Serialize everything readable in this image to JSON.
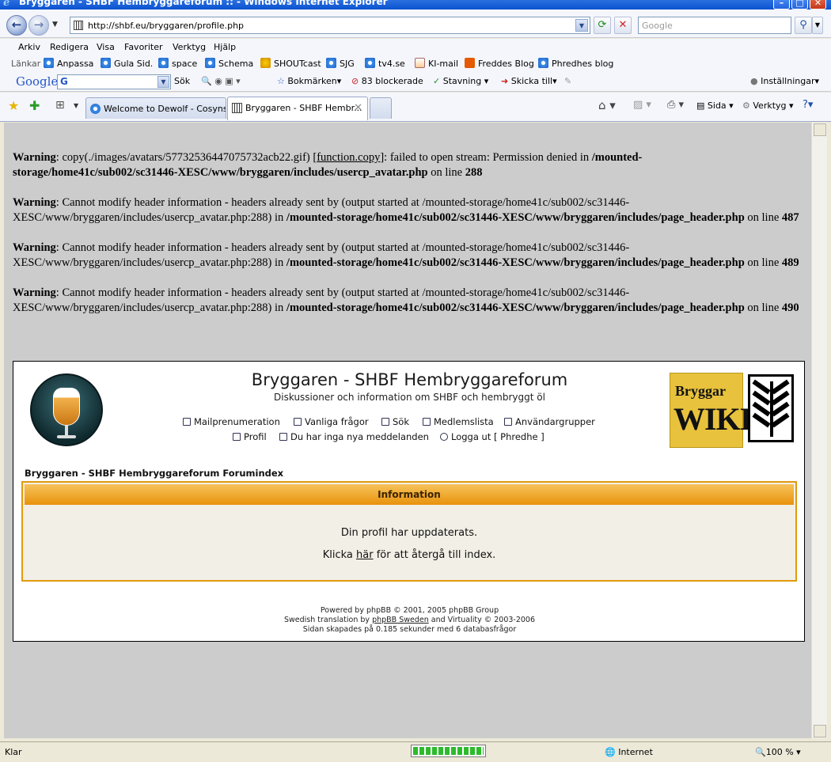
{
  "window": {
    "title": "Bryggaren - SHBF Hembryggareforum :: - Windows Internet Explorer"
  },
  "address": {
    "url": "http://shbf.eu/bryggaren/profile.php",
    "search_placeholder": "Google"
  },
  "menu": [
    "Arkiv",
    "Redigera",
    "Visa",
    "Favoriter",
    "Verktyg",
    "Hjälp"
  ],
  "links_bar": {
    "label": "Länkar",
    "items": [
      "Anpassa",
      "Gula Sid.",
      "space",
      "Schema",
      "SHOUTcast",
      "SJG",
      "tv4.se",
      "KI-mail",
      "Freddes Blog",
      "Phredhes blog"
    ]
  },
  "google_bar": {
    "logo": "Google",
    "select_value": "G",
    "search_label": "Sök",
    "bookmarks": "Bokmärken",
    "blocked": "83 blockerade",
    "spelling": "Stavning",
    "send_to": "Skicka till",
    "settings": "Inställningar"
  },
  "tabs": [
    {
      "label": "Welcome to Dewolf - Cosyns"
    },
    {
      "label": "Bryggaren - SHBF Hembr..."
    }
  ],
  "command_bar": {
    "page": "Sida",
    "tools": "Verktyg"
  },
  "warnings": [
    {
      "label": "Warning",
      "text_a": ": copy(./images/avatars/57732536447075732acb22.gif) [",
      "func": "function.copy",
      "text_b": "]: failed to open stream: Permission denied in ",
      "path": "/mounted-storage/home41c/sub002/sc31446-XESC/www/bryggaren/includes/usercp_avatar.php",
      "on_line": " on line ",
      "line": "288"
    },
    {
      "label": "Warning",
      "text": ": Cannot modify header information - headers already sent by (output started at /mounted-storage/home41c/sub002/sc31446-XESC/www/bryggaren/includes/usercp_avatar.php:288) in ",
      "path": "/mounted-storage/home41c/sub002/sc31446-XESC/www/bryggaren/includes/page_header.php",
      "on_line": " on line ",
      "line": "487"
    },
    {
      "label": "Warning",
      "text": ": Cannot modify header information - headers already sent by (output started at /mounted-storage/home41c/sub002/sc31446-XESC/www/bryggaren/includes/usercp_avatar.php:288) in ",
      "path": "/mounted-storage/home41c/sub002/sc31446-XESC/www/bryggaren/includes/page_header.php",
      "on_line": " on line ",
      "line": "489"
    },
    {
      "label": "Warning",
      "text": ": Cannot modify header information - headers already sent by (output started at /mounted-storage/home41c/sub002/sc31446-XESC/www/bryggaren/includes/usercp_avatar.php:288) in ",
      "path": "/mounted-storage/home41c/sub002/sc31446-XESC/www/bryggaren/includes/page_header.php",
      "on_line": " on line ",
      "line": "490"
    }
  ],
  "forum": {
    "title": "Bryggaren - SHBF Hembryggareforum",
    "subtitle": "Diskussioner och information om SHBF och hembryggt öl",
    "nav_row1": [
      "Mailprenumeration",
      "Vanliga frågor",
      "Sök",
      "Medlemslista",
      "Användargrupper"
    ],
    "nav_row2": [
      "Profil",
      "Du har inga nya meddelanden",
      "Logga ut [ Phredhe ]"
    ],
    "wiki_line1": "Bryggar",
    "wiki_line2": "WIKI",
    "breadcrumb": "Bryggaren - SHBF Hembryggareforum Forumindex",
    "info": {
      "header": "Information",
      "message": "Din profil har uppdaterats.",
      "link_pre": "Klicka ",
      "link": "här",
      "link_post": " för att återgå till index."
    },
    "footer": {
      "line1": "Powered by phpBB © 2001, 2005 phpBB Group",
      "line2_pre": "Swedish translation by ",
      "line2_link": "phpBB Sweden",
      "line2_post": " and Virtuality © 2003-2006",
      "line3": "Sidan skapades på 0.185 sekunder med 6 databasfrågor"
    }
  },
  "status": {
    "left": "Klar",
    "zone": "Internet",
    "zoom": "100 %",
    "progress": 1.0
  }
}
